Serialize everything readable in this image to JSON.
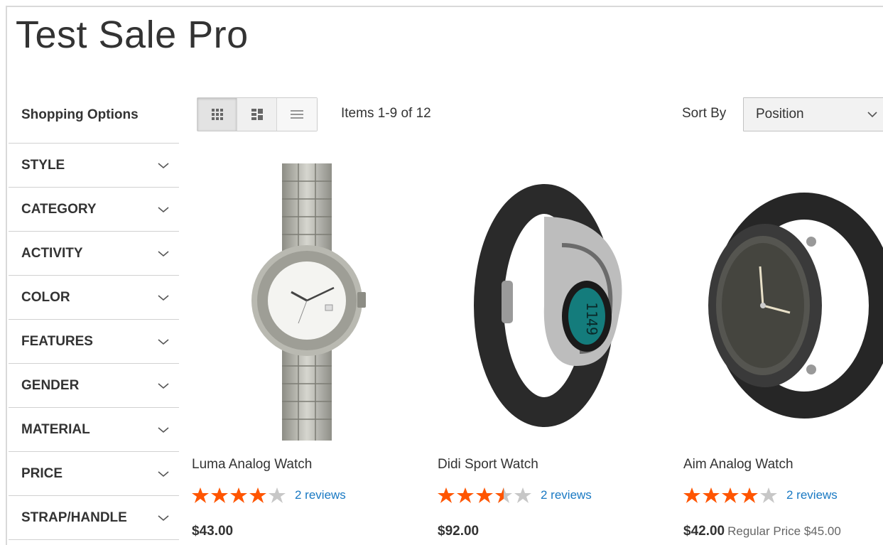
{
  "page": {
    "title": "Test Sale Pro"
  },
  "sidebar": {
    "title": "Shopping Options",
    "filters": [
      "STYLE",
      "CATEGORY",
      "ACTIVITY",
      "COLOR",
      "FEATURES",
      "GENDER",
      "MATERIAL",
      "PRICE",
      "STRAP/HANDLE"
    ]
  },
  "toolbar": {
    "view_modes": [
      "grid",
      "wide-grid",
      "list"
    ],
    "active_mode": "grid",
    "amount": "Items 1-9 of 12",
    "sort_label": "Sort By",
    "sort_value": "Position"
  },
  "products": [
    {
      "name": "Luma Analog Watch",
      "rating": 4,
      "reviews": "2 reviews",
      "price": "$43.00",
      "regular_price": ""
    },
    {
      "name": "Didi Sport Watch",
      "rating": 3.5,
      "reviews": "2 reviews",
      "price": "$92.00",
      "regular_price": ""
    },
    {
      "name": "Aim Analog Watch",
      "rating": 4,
      "reviews": "2 reviews",
      "price": "$42.00",
      "regular_price": "Regular Price $45.00"
    }
  ],
  "colors": {
    "star": "#ff5501",
    "star_empty": "#c7c7c7",
    "link": "#1979c3"
  }
}
